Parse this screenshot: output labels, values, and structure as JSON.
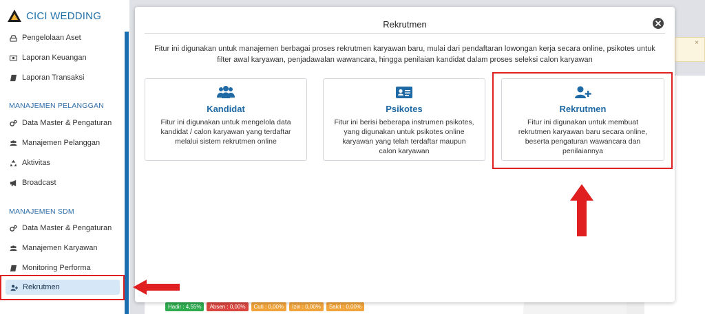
{
  "brand": {
    "name": "CICI WEDDING"
  },
  "sidebar": {
    "top_items": [
      {
        "label": "Pengelolaan Aset",
        "icon": "hdd-icon"
      },
      {
        "label": "Laporan Keuangan",
        "icon": "money-icon"
      },
      {
        "label": "Laporan Transaksi",
        "icon": "book-icon"
      }
    ],
    "section_pelanggan": "MANAJEMEN PELANGGAN",
    "pelanggan_items": [
      {
        "label": "Data Master & Pengaturan",
        "icon": "cogs-icon"
      },
      {
        "label": "Manajemen Pelanggan",
        "icon": "users-icon"
      },
      {
        "label": "Aktivitas",
        "icon": "recycle-icon"
      },
      {
        "label": "Broadcast",
        "icon": "bullhorn-icon"
      }
    ],
    "section_sdm": "MANAJEMEN SDM",
    "sdm_items": [
      {
        "label": "Data Master & Pengaturan",
        "icon": "cogs-icon"
      },
      {
        "label": "Manajemen Karyawan",
        "icon": "users-icon"
      },
      {
        "label": "Monitoring Performa",
        "icon": "book-icon"
      },
      {
        "label": "Rekrutmen",
        "icon": "user-plus-icon"
      }
    ]
  },
  "modal": {
    "title": "Rekrutmen",
    "description": "Fitur ini digunakan untuk manajemen berbagai proses rekrutmen karyawan baru, mulai dari pendaftaran lowongan kerja secara online, psikotes untuk filter awal karyawan, penjadawalan wawancara, hingga penilaian kandidat dalam proses seleksi calon karyawan",
    "options": [
      {
        "title": "Kandidat",
        "icon": "users-icon",
        "description": "Fitur ini digunakan untuk mengelola data kandidat / calon karyawan yang terdaftar melalui sistem rekrutmen online"
      },
      {
        "title": "Psikotes",
        "icon": "id-card-icon",
        "description": "Fitur ini berisi beberapa instrumen psikotes, yang digunakan untuk psikotes online karyawan yang telah terdaftar maupun calon karyawan"
      },
      {
        "title": "Rekrutmen",
        "icon": "user-plus-icon",
        "description": "Fitur ini digunakan untuk membuat rekrutmen karyawan baru secara online, beserta pengaturan wawancara dan penilaiannya"
      }
    ]
  },
  "background": {
    "alert_close": "×",
    "status_badges": [
      {
        "label": "Hadir : 4,55%",
        "color": "#2eaa4f"
      },
      {
        "label": "Absen : 0,00%",
        "color": "#d9463f"
      },
      {
        "label": "Cuti : 0,00%",
        "color": "#f0a33a"
      },
      {
        "label": "Izin : 0,00%",
        "color": "#f0a33a"
      },
      {
        "label": "Sakit : 0,00%",
        "color": "#f0a33a"
      }
    ]
  },
  "colors": {
    "accent": "#1f6aa5",
    "highlight": "#e02020",
    "active_bg": "#d6e7f7"
  }
}
